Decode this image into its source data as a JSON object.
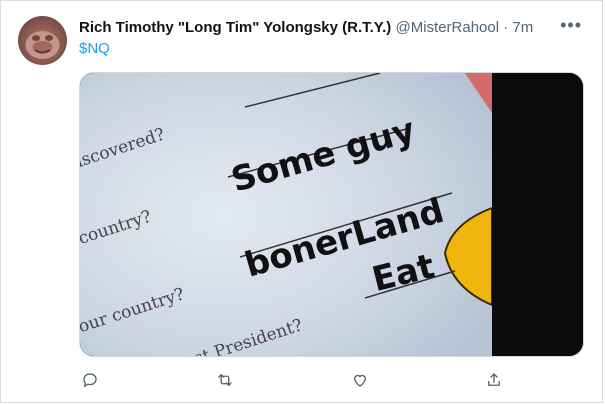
{
  "tweet": {
    "author_name": "Rich Timothy \"Long Tim\" Yolongsky (R.T.Y.)",
    "handle": "@MisterRahool",
    "separator": "·",
    "time": "7m",
    "more_label": "•••",
    "text": "$NQ"
  },
  "media": {
    "image_text": {
      "q1": "iscovered?",
      "q2": "country?",
      "q3": "our country?",
      "q4": "first President?",
      "a1": "Some guy",
      "a2": "bonerLand",
      "a3": "Eat"
    }
  },
  "actions": {
    "icons": [
      "reply-icon",
      "retweet-icon",
      "like-icon",
      "share-icon"
    ]
  },
  "colors": {
    "link": "#1d9bf0",
    "secondary_text": "#536471",
    "border": "#cfd9de"
  }
}
